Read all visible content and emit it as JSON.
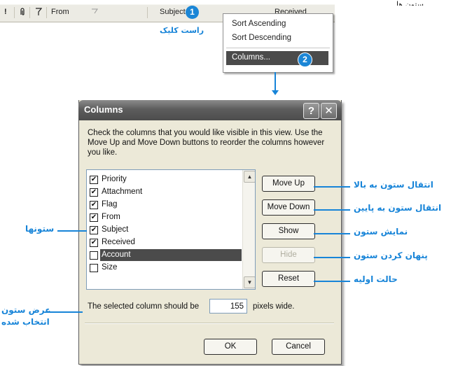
{
  "caption_title": "ستون ها",
  "header_bar": {
    "icons": [
      "!",
      "🖇",
      "⚑"
    ],
    "from_label": "From",
    "subject_label": "Subject",
    "received_label": "Received"
  },
  "context_menu": {
    "items": [
      "Sort Ascending",
      "Sort Descending",
      "Columns..."
    ]
  },
  "annotations": {
    "badge1": "1",
    "badge2": "2",
    "right_click": "راست کلیک",
    "move_up_desc": "انتقال ستون به بالا",
    "move_down_desc": "انتقال ستون به پایین",
    "show_desc": "نمایش ستون",
    "hide_desc": "پنهان کردن ستون",
    "reset_desc": "حالت اولیه",
    "columns_desc": "ستونها",
    "width_desc_1": "عرض ستون",
    "width_desc_2": "انتخاب شده"
  },
  "dialog": {
    "title": "Columns",
    "description": "Check the columns that you would like visible in this view.  Use the Move Up and Move Down buttons to reorder the columns however you like.",
    "columns": [
      {
        "label": "Priority",
        "checked": true
      },
      {
        "label": "Attachment",
        "checked": true
      },
      {
        "label": "Flag",
        "checked": true
      },
      {
        "label": "From",
        "checked": true
      },
      {
        "label": "Subject",
        "checked": true
      },
      {
        "label": "Received",
        "checked": true
      },
      {
        "label": "Account",
        "checked": false,
        "selected": true
      },
      {
        "label": "Size",
        "checked": false
      }
    ],
    "buttons": {
      "move_up": "Move Up",
      "move_down": "Move Down",
      "show": "Show",
      "hide": "Hide",
      "reset": "Reset",
      "ok": "OK",
      "cancel": "Cancel"
    },
    "width_prefix": "The selected column should be",
    "width_value": "155",
    "width_suffix": "pixels wide."
  },
  "colors": {
    "accent": "#1784d8",
    "selection": "#4b4b4b"
  }
}
